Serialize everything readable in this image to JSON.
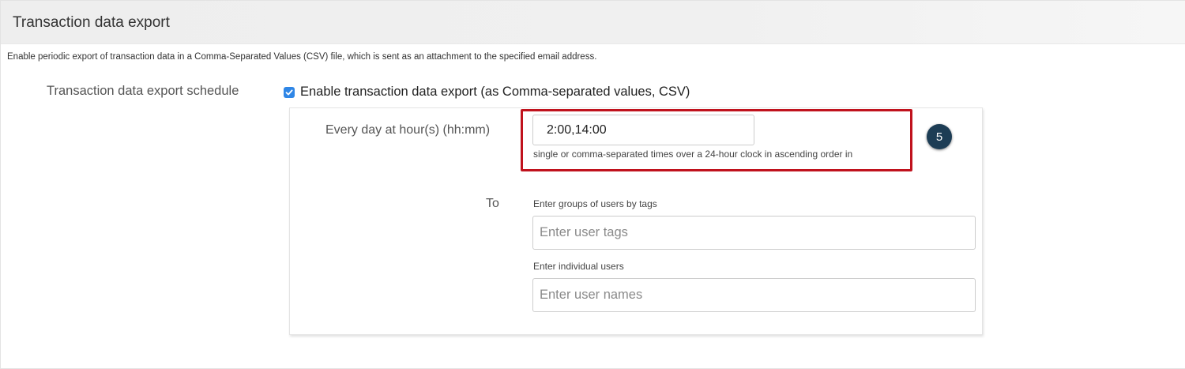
{
  "panel": {
    "title": "Transaction data export",
    "description": "Enable periodic export of transaction data in a Comma-Separated Values (CSV) file, which is sent as an attachment to the specified email address."
  },
  "schedule": {
    "label": "Transaction data export schedule",
    "enable_checkbox": {
      "label": "Enable transaction data export (as Comma-separated values, CSV)",
      "checked": true,
      "color": "#2f86e6"
    }
  },
  "hours": {
    "label": "Every day at hour(s) (hh:mm)",
    "value": "2:00,14:00",
    "help": "single or comma-separated times over a 24-hour clock in ascending order in"
  },
  "annotation": {
    "step_number": "5",
    "highlight_color": "#c0121d",
    "badge_color": "#1d3d55"
  },
  "recipients": {
    "to_label": "To",
    "tags_label": "Enter groups of users by tags",
    "tags_placeholder": "Enter user tags",
    "users_label": "Enter individual users",
    "users_placeholder": "Enter user names"
  }
}
